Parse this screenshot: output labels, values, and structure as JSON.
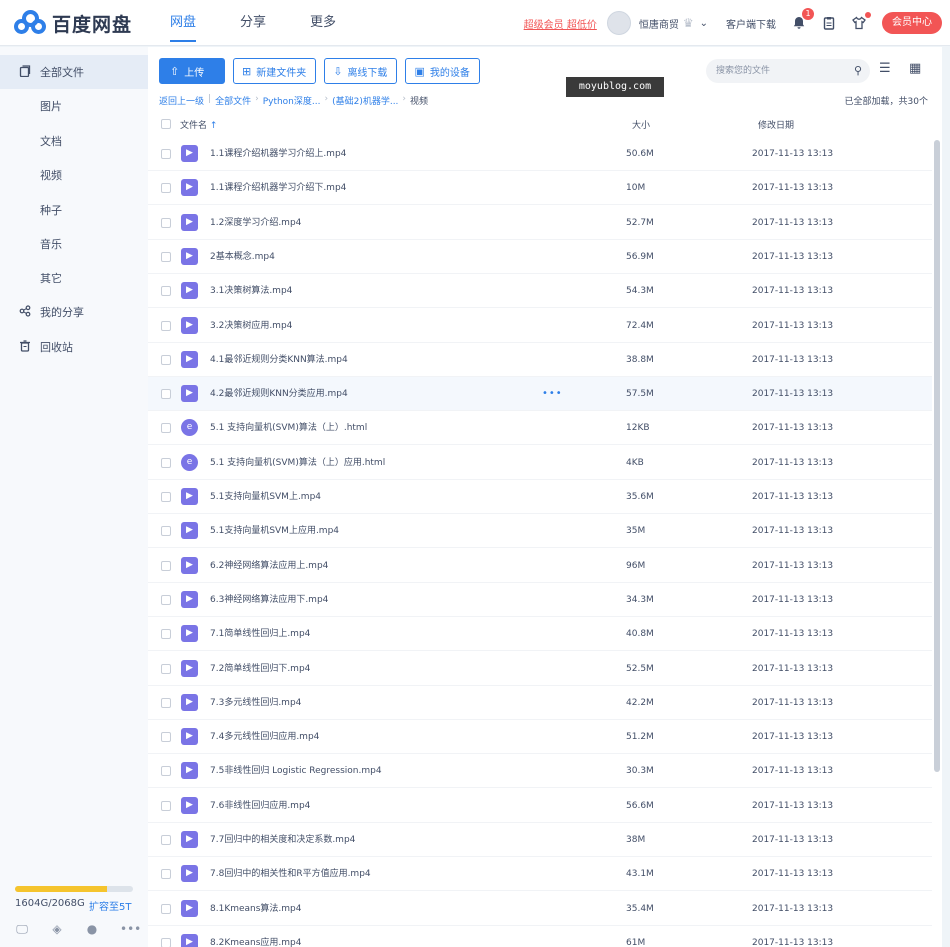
{
  "header": {
    "logo_text": "百度网盘",
    "nav": [
      "网盘",
      "分享",
      "更多"
    ],
    "promo": "超级会员 超低价",
    "username": "恒唐商贸",
    "client_download": "客户端下载",
    "notification_count": "1",
    "vip_button": "会员中心"
  },
  "sidebar": {
    "items": [
      {
        "label": "全部文件",
        "icon": "file-icon"
      },
      {
        "label": "图片"
      },
      {
        "label": "文档"
      },
      {
        "label": "视频"
      },
      {
        "label": "种子"
      },
      {
        "label": "音乐"
      },
      {
        "label": "其它"
      },
      {
        "label": "我的分享",
        "icon": "share-icon"
      },
      {
        "label": "回收站",
        "icon": "trash-icon"
      }
    ],
    "quota_text": "1604G/2068G",
    "quota_fraction": 0.776,
    "quota_link": "扩容至5T"
  },
  "toolbar": {
    "upload": "上传",
    "new_folder": "新建文件夹",
    "offline_download": "离线下载",
    "my_devices": "我的设备",
    "search_placeholder": "搜索您的文件"
  },
  "watermark": "moyublog.com",
  "breadcrumb": {
    "back": "返回上一级",
    "items": [
      "全部文件",
      "Python深度...",
      "(基础2)机器学..."
    ],
    "current": "视频"
  },
  "loaded_text": "已全部加载，共30个",
  "columns": {
    "name": "文件名",
    "size": "大小",
    "date": "修改日期"
  },
  "files": [
    {
      "name": "1.1课程介绍机器学习介绍上.mp4",
      "size": "50.6M",
      "date": "2017-11-13 13:13",
      "type": "video"
    },
    {
      "name": "1.1课程介绍机器学习介绍下.mp4",
      "size": "10M",
      "date": "2017-11-13 13:13",
      "type": "video"
    },
    {
      "name": "1.2深度学习介绍.mp4",
      "size": "52.7M",
      "date": "2017-11-13 13:13",
      "type": "video"
    },
    {
      "name": "2基本概念.mp4",
      "size": "56.9M",
      "date": "2017-11-13 13:13",
      "type": "video"
    },
    {
      "name": "3.1决策树算法.mp4",
      "size": "54.3M",
      "date": "2017-11-13 13:13",
      "type": "video"
    },
    {
      "name": "3.2决策树应用.mp4",
      "size": "72.4M",
      "date": "2017-11-13 13:13",
      "type": "video"
    },
    {
      "name": "4.1最邻近规则分类KNN算法.mp4",
      "size": "38.8M",
      "date": "2017-11-13 13:13",
      "type": "video"
    },
    {
      "name": "4.2最邻近规则KNN分类应用.mp4",
      "size": "57.5M",
      "date": "2017-11-13 13:13",
      "type": "video"
    },
    {
      "name": "5.1 支持向量机(SVM)算法（上）.html",
      "size": "12KB",
      "date": "2017-11-13 13:13",
      "type": "html"
    },
    {
      "name": "5.1 支持向量机(SVM)算法（上）应用.html",
      "size": "4KB",
      "date": "2017-11-13 13:13",
      "type": "html"
    },
    {
      "name": "5.1支持向量机SVM上.mp4",
      "size": "35.6M",
      "date": "2017-11-13 13:13",
      "type": "video"
    },
    {
      "name": "5.1支持向量机SVM上应用.mp4",
      "size": "35M",
      "date": "2017-11-13 13:13",
      "type": "video"
    },
    {
      "name": "6.2神经网络算法应用上.mp4",
      "size": "96M",
      "date": "2017-11-13 13:13",
      "type": "video"
    },
    {
      "name": "6.3神经网络算法应用下.mp4",
      "size": "34.3M",
      "date": "2017-11-13 13:13",
      "type": "video"
    },
    {
      "name": "7.1简单线性回归上.mp4",
      "size": "40.8M",
      "date": "2017-11-13 13:13",
      "type": "video"
    },
    {
      "name": "7.2简单线性回归下.mp4",
      "size": "52.5M",
      "date": "2017-11-13 13:13",
      "type": "video"
    },
    {
      "name": "7.3多元线性回归.mp4",
      "size": "42.2M",
      "date": "2017-11-13 13:13",
      "type": "video"
    },
    {
      "name": "7.4多元线性回归应用.mp4",
      "size": "51.2M",
      "date": "2017-11-13 13:13",
      "type": "video"
    },
    {
      "name": "7.5非线性回归 Logistic Regression.mp4",
      "size": "30.3M",
      "date": "2017-11-13 13:13",
      "type": "video"
    },
    {
      "name": "7.6非线性回归应用.mp4",
      "size": "56.6M",
      "date": "2017-11-13 13:13",
      "type": "video"
    },
    {
      "name": "7.7回归中的相关度和决定系数.mp4",
      "size": "38M",
      "date": "2017-11-13 13:13",
      "type": "video"
    },
    {
      "name": "7.8回归中的相关性和R平方值应用.mp4",
      "size": "43.1M",
      "date": "2017-11-13 13:13",
      "type": "video"
    },
    {
      "name": "8.1Kmeans算法.mp4",
      "size": "35.4M",
      "date": "2017-11-13 13:13",
      "type": "video"
    },
    {
      "name": "8.2Kmeans应用.mp4",
      "size": "61M",
      "date": "2017-11-13 13:13",
      "type": "video"
    }
  ],
  "hovered_row": 7,
  "accent": "#2e7fe8",
  "danger": "#f25555"
}
